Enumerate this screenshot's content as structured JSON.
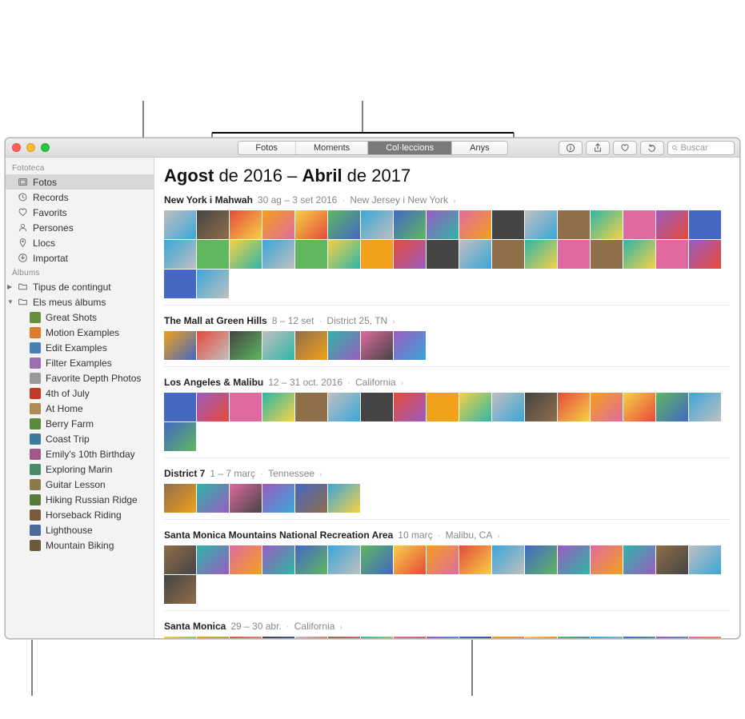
{
  "toolbar": {
    "segments": [
      "Fotos",
      "Moments",
      "Col·leccions",
      "Anys"
    ],
    "selected_index": 2,
    "search_placeholder": "Buscar"
  },
  "sidebar": {
    "sections": [
      {
        "title": "Fototeca",
        "items": [
          {
            "label": "Fotos",
            "icon": "photos",
            "selected": true
          },
          {
            "label": "Records",
            "icon": "clock"
          },
          {
            "label": "Favorits",
            "icon": "heart"
          },
          {
            "label": "Persones",
            "icon": "person"
          },
          {
            "label": "Llocs",
            "icon": "pin"
          },
          {
            "label": "Importat",
            "icon": "import"
          }
        ]
      },
      {
        "title": "Àlbums",
        "items": [
          {
            "label": "Tipus de contingut",
            "icon": "folder",
            "disclosure": "right"
          },
          {
            "label": "Els meus àlbums",
            "icon": "folder",
            "disclosure": "down",
            "children": [
              {
                "label": "Great Shots",
                "color": "#6a8f3c"
              },
              {
                "label": "Motion Examples",
                "color": "#e07b2c"
              },
              {
                "label": "Edit Examples",
                "color": "#4a7fb0"
              },
              {
                "label": "Filter Examples",
                "color": "#9a6fb0"
              },
              {
                "label": "Favorite Depth Photos",
                "color": "#999999"
              },
              {
                "label": "4th of July",
                "color": "#c0392b"
              },
              {
                "label": "At Home",
                "color": "#b08a54"
              },
              {
                "label": "Berry Farm",
                "color": "#5a8a3a"
              },
              {
                "label": "Coast Trip",
                "color": "#3a7a9a"
              },
              {
                "label": "Emily's 10th Birthday",
                "color": "#a05a8a"
              },
              {
                "label": "Exploring Marin",
                "color": "#4a8a6a"
              },
              {
                "label": "Guitar Lesson",
                "color": "#8a7a4a"
              },
              {
                "label": "Hiking Russian Ridge",
                "color": "#5a7a3a"
              },
              {
                "label": "Horseback Riding",
                "color": "#7a5a3a"
              },
              {
                "label": "Lighthouse",
                "color": "#4a6a9a"
              },
              {
                "label": "Mountain Biking",
                "color": "#6a5a3a"
              }
            ]
          }
        ]
      }
    ]
  },
  "main": {
    "title_strong1": "Agost",
    "title_span1": " de 2016 – ",
    "title_strong2": "Abril",
    "title_span2": " de 2017",
    "collections": [
      {
        "name": "New York i Mahwah",
        "date": "30 ag – 3 set 2016",
        "loc": "New Jersey i New York",
        "rows": 2,
        "cols": 18
      },
      {
        "name": "The Mall at Green Hills",
        "date": "8 – 12 set",
        "loc": "District 25, TN",
        "rows": 1,
        "cols": 8
      },
      {
        "name": "Los Angeles & Malibu",
        "date": "12 – 31 oct. 2016",
        "loc": "California",
        "rows": 1,
        "cols": 18
      },
      {
        "name": "District 7",
        "date": "1 – 7 març",
        "loc": "Tennessee",
        "rows": 1,
        "cols": 6
      },
      {
        "name": "Santa Monica Mountains National Recreation Area",
        "date": "10 març",
        "loc": "Malibu, CA",
        "rows": 1,
        "cols": 18
      },
      {
        "name": "Santa Monica",
        "date": "29 – 30 abr.",
        "loc": "California",
        "rows": 1,
        "cols": 18
      }
    ]
  },
  "palette": [
    "#e64a3a",
    "#f2a11b",
    "#f7d146",
    "#5fb760",
    "#3aa6d8",
    "#4467c4",
    "#9a5cc0",
    "#e06aa0",
    "#2db6a6",
    "#8f6e4a",
    "#c0c0c0",
    "#444"
  ]
}
